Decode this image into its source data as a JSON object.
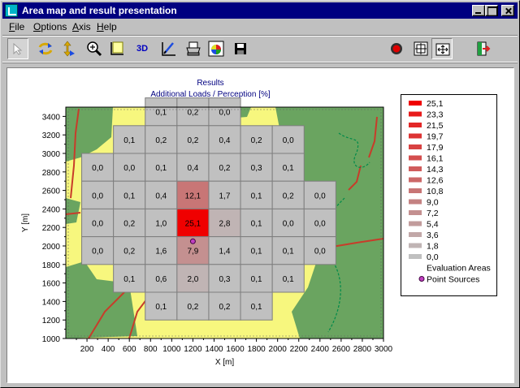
{
  "window": {
    "title": "Area map and result presentation"
  },
  "menu": [
    {
      "label": "File",
      "mnemonic": "F",
      "rest": "ile"
    },
    {
      "label": "Options",
      "mnemonic": "O",
      "rest": "ptions"
    },
    {
      "label": "Axis",
      "mnemonic": "A",
      "rest": "xis"
    },
    {
      "label": "Help",
      "mnemonic": "H",
      "rest": "elp"
    }
  ],
  "toolbar": {
    "three_d_label": "3D",
    "icons": [
      "select-arrow-icon",
      "rotate-arrows-icon",
      "vertical-arrows-icon",
      "zoom-icon",
      "axis-frame-icon",
      "3d-icon",
      "draw-icon",
      "print-icon",
      "color-palette-icon",
      "save-icon",
      "record-icon",
      "fit-view-icon",
      "fit-page-icon",
      "exit-icon"
    ]
  },
  "chart_data": {
    "type": "heatmap",
    "title": "Results",
    "subtitle": "Additional Loads / Perception [%]",
    "xlabel": "X [m]",
    "ylabel": "Y [m]",
    "xlim": [
      0,
      3000
    ],
    "ylim": [
      1000,
      3500
    ],
    "xticks": [
      200,
      400,
      600,
      800,
      1000,
      1200,
      1400,
      1600,
      1800,
      2000,
      2200,
      2400,
      2600,
      2800,
      3000
    ],
    "yticks": [
      1000,
      1200,
      1400,
      1600,
      1800,
      2000,
      2200,
      2400,
      2600,
      2800,
      3000,
      3200,
      3400
    ],
    "cell_size": 300,
    "cells": [
      {
        "x0": 750,
        "y0": 3300,
        "label": "0,1",
        "value": 0.1
      },
      {
        "x0": 1050,
        "y0": 3300,
        "label": "0,2",
        "value": 0.2
      },
      {
        "x0": 1350,
        "y0": 3300,
        "label": "0,0",
        "value": 0.0
      },
      {
        "x0": 450,
        "y0": 3000,
        "label": "0,1",
        "value": 0.1
      },
      {
        "x0": 750,
        "y0": 3000,
        "label": "0,2",
        "value": 0.2
      },
      {
        "x0": 1050,
        "y0": 3000,
        "label": "0,2",
        "value": 0.2
      },
      {
        "x0": 1350,
        "y0": 3000,
        "label": "0,4",
        "value": 0.4
      },
      {
        "x0": 1650,
        "y0": 3000,
        "label": "0,2",
        "value": 0.2
      },
      {
        "x0": 1950,
        "y0": 3000,
        "label": "0,0",
        "value": 0.0
      },
      {
        "x0": 150,
        "y0": 2700,
        "label": "0,0",
        "value": 0.0
      },
      {
        "x0": 450,
        "y0": 2700,
        "label": "0,0",
        "value": 0.0
      },
      {
        "x0": 750,
        "y0": 2700,
        "label": "0,1",
        "value": 0.1
      },
      {
        "x0": 1050,
        "y0": 2700,
        "label": "0,4",
        "value": 0.4
      },
      {
        "x0": 1350,
        "y0": 2700,
        "label": "0,2",
        "value": 0.2
      },
      {
        "x0": 1650,
        "y0": 2700,
        "label": "0,3",
        "value": 0.3
      },
      {
        "x0": 1950,
        "y0": 2700,
        "label": "0,1",
        "value": 0.1
      },
      {
        "x0": 150,
        "y0": 2400,
        "label": "0,0",
        "value": 0.0
      },
      {
        "x0": 450,
        "y0": 2400,
        "label": "0,1",
        "value": 0.1
      },
      {
        "x0": 750,
        "y0": 2400,
        "label": "0,4",
        "value": 0.4
      },
      {
        "x0": 1050,
        "y0": 2400,
        "label": "12,1",
        "value": 12.1
      },
      {
        "x0": 1350,
        "y0": 2400,
        "label": "1,7",
        "value": 1.7
      },
      {
        "x0": 1650,
        "y0": 2400,
        "label": "0,1",
        "value": 0.1
      },
      {
        "x0": 1950,
        "y0": 2400,
        "label": "0,2",
        "value": 0.2
      },
      {
        "x0": 2250,
        "y0": 2400,
        "label": "0,0",
        "value": 0.0
      },
      {
        "x0": 150,
        "y0": 2100,
        "label": "0,0",
        "value": 0.0
      },
      {
        "x0": 450,
        "y0": 2100,
        "label": "0,2",
        "value": 0.2
      },
      {
        "x0": 750,
        "y0": 2100,
        "label": "1,0",
        "value": 1.0
      },
      {
        "x0": 1050,
        "y0": 2100,
        "label": "25,1",
        "value": 25.1
      },
      {
        "x0": 1350,
        "y0": 2100,
        "label": "2,8",
        "value": 2.8
      },
      {
        "x0": 1650,
        "y0": 2100,
        "label": "0,1",
        "value": 0.1
      },
      {
        "x0": 1950,
        "y0": 2100,
        "label": "0,0",
        "value": 0.0
      },
      {
        "x0": 2250,
        "y0": 2100,
        "label": "0,0",
        "value": 0.0
      },
      {
        "x0": 150,
        "y0": 1800,
        "label": "0,0",
        "value": 0.0
      },
      {
        "x0": 450,
        "y0": 1800,
        "label": "0,2",
        "value": 0.2
      },
      {
        "x0": 750,
        "y0": 1800,
        "label": "1,6",
        "value": 1.6
      },
      {
        "x0": 1050,
        "y0": 1800,
        "label": "7,9",
        "value": 7.9
      },
      {
        "x0": 1350,
        "y0": 1800,
        "label": "1,4",
        "value": 1.4
      },
      {
        "x0": 1650,
        "y0": 1800,
        "label": "0,1",
        "value": 0.1
      },
      {
        "x0": 1950,
        "y0": 1800,
        "label": "0,1",
        "value": 0.1
      },
      {
        "x0": 2250,
        "y0": 1800,
        "label": "0,0",
        "value": 0.0
      },
      {
        "x0": 450,
        "y0": 1500,
        "label": "0,1",
        "value": 0.1
      },
      {
        "x0": 750,
        "y0": 1500,
        "label": "0,6",
        "value": 0.6
      },
      {
        "x0": 1050,
        "y0": 1500,
        "label": "2,0",
        "value": 2.0
      },
      {
        "x0": 1350,
        "y0": 1500,
        "label": "0,3",
        "value": 0.3
      },
      {
        "x0": 1650,
        "y0": 1500,
        "label": "0,1",
        "value": 0.1
      },
      {
        "x0": 1950,
        "y0": 1500,
        "label": "0,1",
        "value": 0.1
      },
      {
        "x0": 750,
        "y0": 1200,
        "label": "0,1",
        "value": 0.1
      },
      {
        "x0": 1050,
        "y0": 1200,
        "label": "0,2",
        "value": 0.2
      },
      {
        "x0": 1350,
        "y0": 1200,
        "label": "0,2",
        "value": 0.2
      },
      {
        "x0": 1650,
        "y0": 1200,
        "label": "0,1",
        "value": 0.1
      }
    ],
    "point_source": {
      "x": 1200,
      "y": 2050
    },
    "legend": {
      "placement": "right",
      "entries": [
        {
          "label": "25,1",
          "color": "#f00000"
        },
        {
          "label": "23,3",
          "color": "#e81c1c"
        },
        {
          "label": "21,5",
          "color": "#e32828"
        },
        {
          "label": "19,7",
          "color": "#dd3434"
        },
        {
          "label": "17,9",
          "color": "#d84242"
        },
        {
          "label": "16,1",
          "color": "#d44e4e"
        },
        {
          "label": "14,3",
          "color": "#d05c5c"
        },
        {
          "label": "12,6",
          "color": "#cc6868"
        },
        {
          "label": "10,8",
          "color": "#c87676"
        },
        {
          "label": "9,0",
          "color": "#c48282"
        },
        {
          "label": "7,2",
          "color": "#c49090"
        },
        {
          "label": "5,4",
          "color": "#c29c9c"
        },
        {
          "label": "3,6",
          "color": "#c2a8a8"
        },
        {
          "label": "1,8",
          "color": "#c0b4b4"
        },
        {
          "label": "0,0",
          "color": "#c0c0c0"
        }
      ],
      "evaluation_areas": "Evaluation Areas",
      "point_sources": "Point Sources"
    },
    "colors": {
      "map_background": "#f7f77e",
      "forest": "#6aa460",
      "road": "#c83c2a",
      "cell_border": "#7e7e7e",
      "title": "#000080",
      "point_source": "#c040c0"
    }
  }
}
